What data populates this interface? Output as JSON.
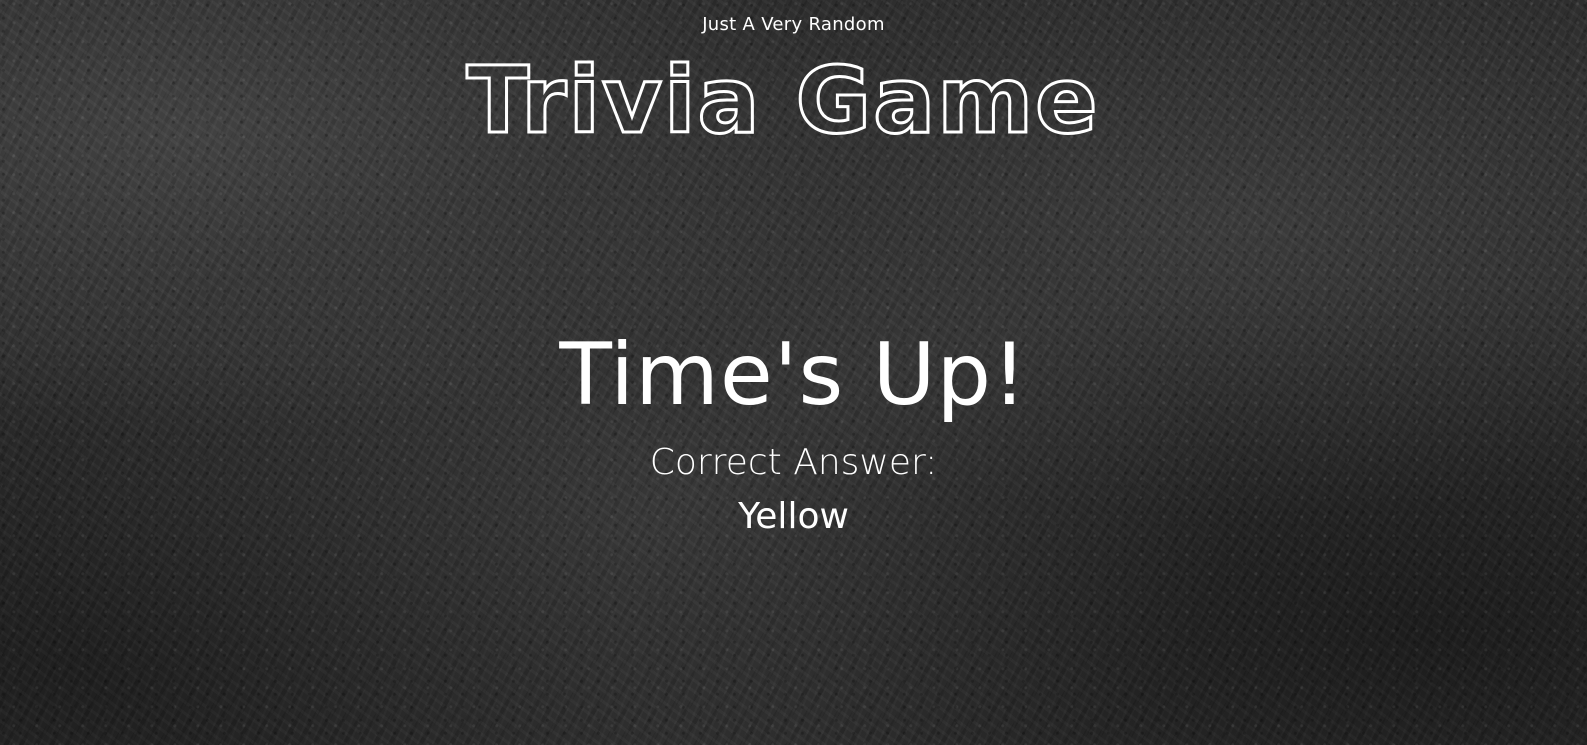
{
  "header": {
    "subtitle": "Just A Very Random",
    "logo_text": "Trivia Game"
  },
  "result": {
    "title": "Time's Up!",
    "answer_label": "Correct Answer:",
    "answer_value": "Yellow"
  },
  "colors": {
    "text": "#ffffff",
    "background": "#2b2b2b"
  }
}
